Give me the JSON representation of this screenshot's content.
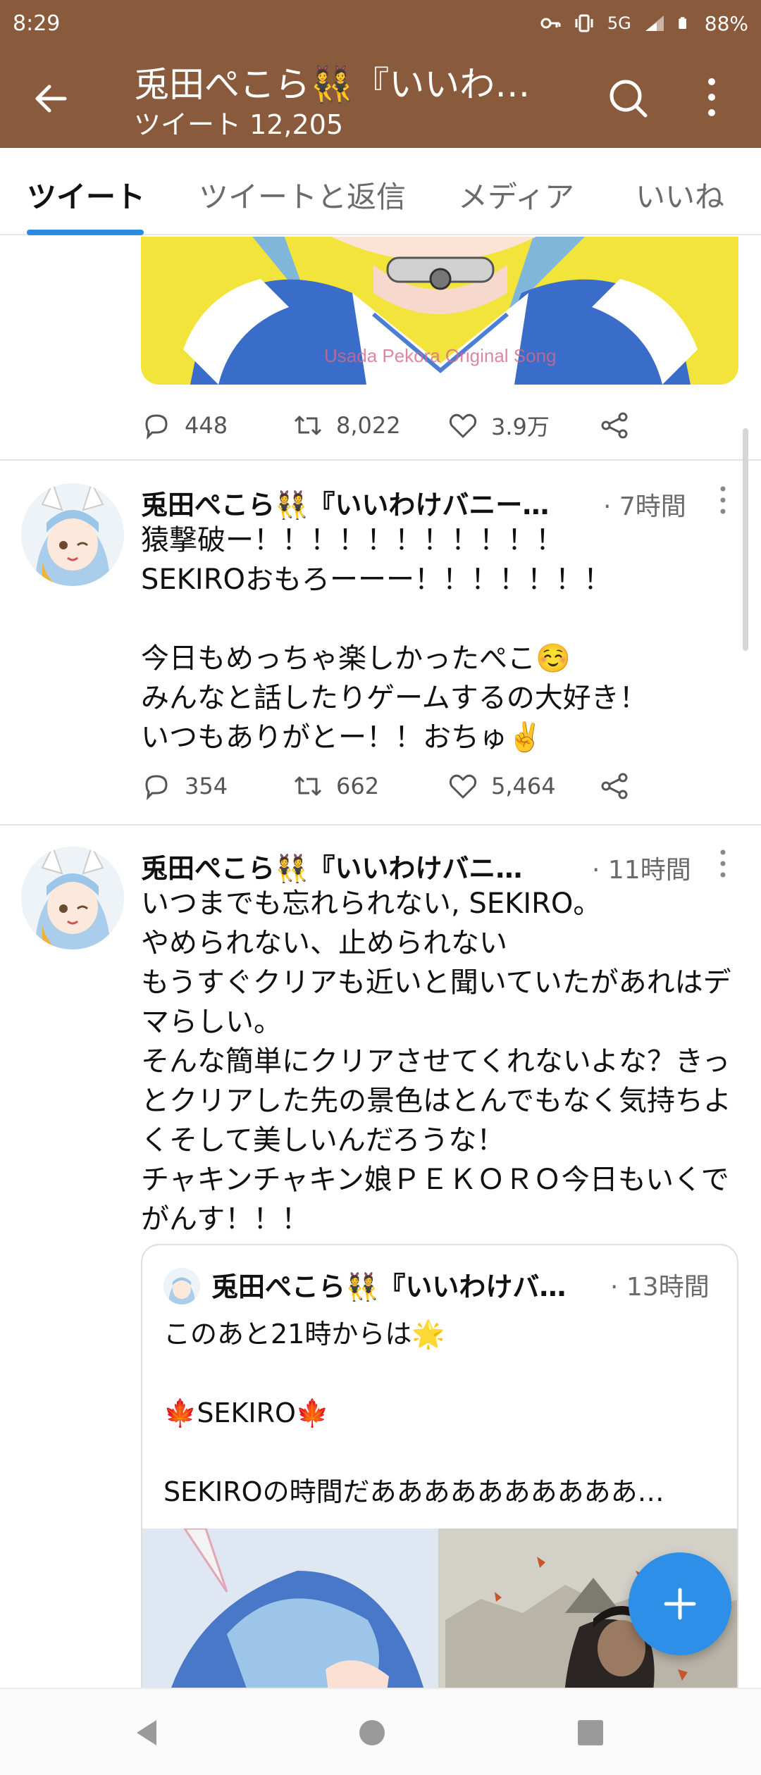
{
  "status_bar": {
    "time": "8:29",
    "network": "5G",
    "battery": "88%"
  },
  "app_bar": {
    "title": "兎田ぺこら👯『いいわ…",
    "subtitle": "ツイート 12,205",
    "back_icon": "arrow-left-icon",
    "search_icon": "search-icon",
    "more_icon": "vertical-dots-icon"
  },
  "tabs": [
    {
      "label": "ツイート",
      "active": true
    },
    {
      "label": "ツイートと返信",
      "active": false
    },
    {
      "label": "メディア",
      "active": false
    },
    {
      "label": "いいね",
      "active": false
    }
  ],
  "tweets": [
    {
      "image_watermark": "Usada Pekora Original Song",
      "replies": "448",
      "retweets": "8,022",
      "likes": "3.9万"
    },
    {
      "name": "兎田ぺこら👯『いいわけバニー…",
      "time": "· 7時間",
      "text": "猿撃破ー！！！！！！！！！！！\nSEKIROおもろーーー！！！！！！！\n\n今日もめっちゃ楽しかったぺこ☺️\nみんなと話したりゲームするの大好き！\nいつもありがとー！！おちゅ✌️",
      "replies": "354",
      "retweets": "662",
      "likes": "5,464"
    },
    {
      "name": "兎田ぺこら👯『いいわけバニ…",
      "time": "· 11時間",
      "text": "いつまでも忘れられない, SEKIRO。\nやめられない、止められない\nもうすぐクリアも近いと聞いていたがあれはデマらしい。\nそんな簡単にクリアさせてくれないよな？きっとクリアした先の景色はとんでもなく気持ちよくそして美しいんだろうな！\nチャキンチャキン娘ＰＥＫＯＲＯ今日もいくでがんす！！！",
      "quote": {
        "name": "兎田ぺこら👯『いいわけバ…",
        "time": "· 13時間",
        "text": "このあと21時からは🌟\n\n🍁SEKIRO🍁\n\nSEKIROの時間だああああああああああ…"
      }
    }
  ],
  "fab_icon": "plus-icon",
  "nav": [
    "back-triangle-icon",
    "home-circle-icon",
    "recents-square-icon"
  ],
  "colors": {
    "app_bar": "#8a5a3c",
    "accent": "#2d8fe8",
    "image_bg": "#f2e43a"
  }
}
